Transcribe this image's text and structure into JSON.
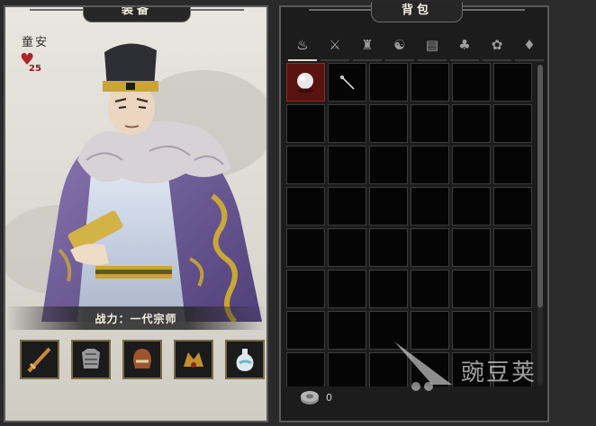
{
  "equipment": {
    "header": "装备",
    "character_name": "童安",
    "favor": {
      "icon": "heart-icon",
      "value": "25"
    },
    "combat_power_text": "战力：一代宗师",
    "slots": [
      {
        "icon": "sword-icon"
      },
      {
        "icon": "armor-icon"
      },
      {
        "icon": "helmet-icon"
      },
      {
        "icon": "accessory-icon"
      },
      {
        "icon": "potion-icon"
      }
    ]
  },
  "bag": {
    "header": "背包",
    "tabs": [
      {
        "icon": "all-items-icon",
        "active": true
      },
      {
        "icon": "crossed-swords-icon",
        "active": false
      },
      {
        "icon": "clothing-icon",
        "active": false
      },
      {
        "icon": "cultivation-icon",
        "active": false
      },
      {
        "icon": "book-icon",
        "active": false
      },
      {
        "icon": "herb-icon",
        "active": false
      },
      {
        "icon": "pet-icon",
        "active": false
      },
      {
        "icon": "misc-icon",
        "active": false
      }
    ],
    "items": [
      {
        "slot": 0,
        "icon": "pearl-icon",
        "selected": true
      },
      {
        "slot": 1,
        "icon": "needle-icon",
        "selected": false
      }
    ],
    "money": {
      "icon": "coin-icon",
      "value": "0"
    }
  },
  "watermark": {
    "text": "豌豆荚"
  },
  "colors": {
    "selected_cell": "#5a1210",
    "frame": "#7a6a45",
    "heart": "#b0252a"
  }
}
